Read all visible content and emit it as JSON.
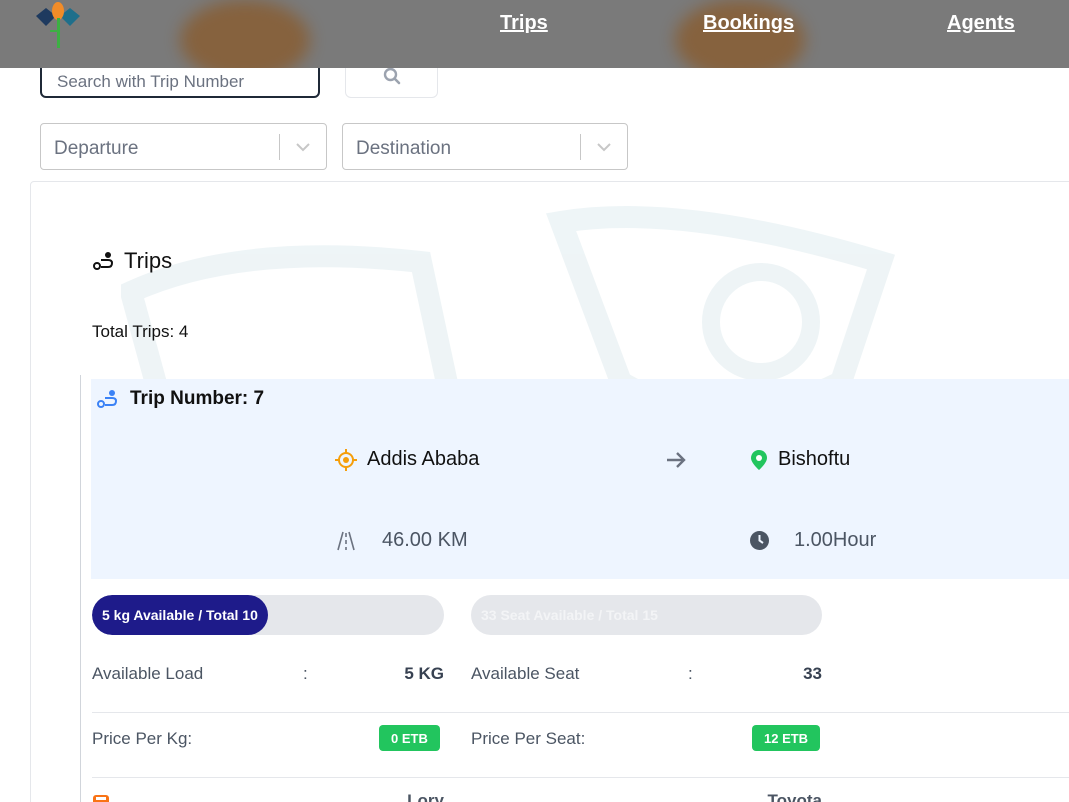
{
  "nav": {
    "items": [
      {
        "label": "Trips"
      },
      {
        "label": "Bookings"
      },
      {
        "label": "Agents"
      }
    ]
  },
  "search": {
    "placeholder": "Search with Trip Number",
    "icon": "search-icon"
  },
  "filters": {
    "departure_placeholder": "Departure",
    "destination_placeholder": "Destination"
  },
  "trips": {
    "title": "Trips",
    "total_label": "Total Trips: 4"
  },
  "trip": {
    "number_label": "Trip Number: 7",
    "origin": "Addis Ababa",
    "destination": "Bishoftu",
    "distance": "46.00 KM",
    "duration": "1.00Hour",
    "load_bar": {
      "label": "5 kg Available / Total 10",
      "fraction": 0.5
    },
    "seat_bar": {
      "label": "33 Seat Available / Total 15",
      "fraction": 0
    },
    "available_load_label": "Available Load",
    "available_load_value": "5 KG",
    "available_seat_label": "Available Seat",
    "available_seat_value": "33",
    "price_per_kg_label": "Price Per Kg:",
    "price_per_kg_value": "0 ETB",
    "price_per_seat_label": "Price Per Seat:",
    "price_per_seat_value": "12 ETB",
    "vehicle_type": "Lory",
    "vehicle_make": "Toyota"
  },
  "colors": {
    "header_bg": "#7a7a7a",
    "trip_head_bg": "#eef5ff",
    "progress_fill": "#1e1b8a",
    "badge_green": "#22c55e",
    "origin_icon": "#f59e0b",
    "destination_icon": "#22c55e",
    "trip_icon_blue": "#3b82f6"
  }
}
